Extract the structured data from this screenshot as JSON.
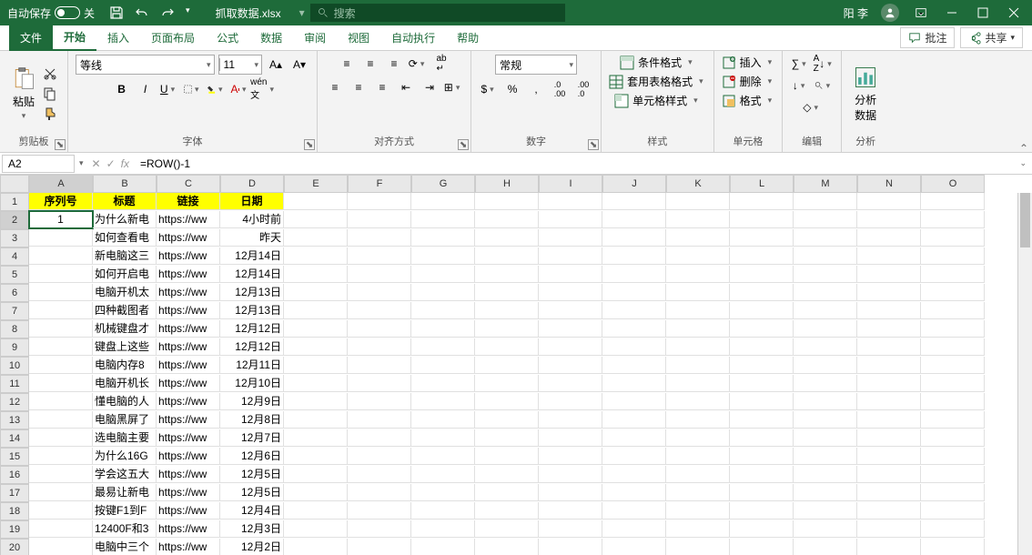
{
  "titlebar": {
    "autosave_label": "自动保存",
    "autosave_off": "关",
    "filename": "抓取数据.xlsx",
    "search_placeholder": "搜索",
    "username": "阳 李"
  },
  "tabs": {
    "file": "文件",
    "home": "开始",
    "insert": "插入",
    "layout": "页面布局",
    "formulas": "公式",
    "data": "数据",
    "review": "审阅",
    "view": "视图",
    "automate": "自动执行",
    "help": "帮助",
    "comments": "批注",
    "share": "共享"
  },
  "ribbon": {
    "clipboard": {
      "label": "剪贴板",
      "paste": "粘贴"
    },
    "font": {
      "label": "字体",
      "name": "等线",
      "size": "11"
    },
    "align": {
      "label": "对齐方式"
    },
    "number": {
      "label": "数字",
      "format": "常规"
    },
    "styles": {
      "label": "样式",
      "cond": "条件格式",
      "table": "套用表格格式",
      "cell": "单元格样式"
    },
    "cells": {
      "label": "单元格",
      "insert": "插入",
      "delete": "删除",
      "format": "格式"
    },
    "editing": {
      "label": "编辑"
    },
    "analysis": {
      "label": "分析",
      "btn": "分析\n数据"
    }
  },
  "formulabar": {
    "namebox": "A2",
    "formula": "=ROW()-1"
  },
  "columns": [
    "A",
    "B",
    "C",
    "D",
    "E",
    "F",
    "G",
    "H",
    "I",
    "J",
    "K",
    "L",
    "M",
    "N",
    "O"
  ],
  "headers": {
    "a": "序列号",
    "b": "标题",
    "c": "链接",
    "d": "日期"
  },
  "rows": [
    {
      "n": 1,
      "a": "1",
      "b": "为什么新电",
      "c": "https://ww",
      "d": "4小时前"
    },
    {
      "n": 2,
      "a": "",
      "b": "如何查看电",
      "c": "https://ww",
      "d": "昨天"
    },
    {
      "n": 3,
      "a": "",
      "b": "新电脑这三",
      "c": "https://ww",
      "d": "12月14日"
    },
    {
      "n": 4,
      "a": "",
      "b": "如何开启电",
      "c": "https://ww",
      "d": "12月14日"
    },
    {
      "n": 5,
      "a": "",
      "b": "电脑开机太",
      "c": "https://ww",
      "d": "12月13日"
    },
    {
      "n": 6,
      "a": "",
      "b": "四种截图者",
      "c": "https://ww",
      "d": "12月13日"
    },
    {
      "n": 7,
      "a": "",
      "b": "机械键盘才",
      "c": "https://ww",
      "d": "12月12日"
    },
    {
      "n": 8,
      "a": "",
      "b": "键盘上这些",
      "c": "https://ww",
      "d": "12月12日"
    },
    {
      "n": 9,
      "a": "",
      "b": "电脑内存8",
      "c": "https://ww",
      "d": "12月11日"
    },
    {
      "n": 10,
      "a": "",
      "b": "电脑开机长",
      "c": "https://ww",
      "d": "12月10日"
    },
    {
      "n": 11,
      "a": "",
      "b": "懂电脑的人",
      "c": "https://ww",
      "d": "12月9日"
    },
    {
      "n": 12,
      "a": "",
      "b": "电脑黑屏了",
      "c": "https://ww",
      "d": "12月8日"
    },
    {
      "n": 13,
      "a": "",
      "b": "选电脑主要",
      "c": "https://ww",
      "d": "12月7日"
    },
    {
      "n": 14,
      "a": "",
      "b": "为什么16G",
      "c": "https://ww",
      "d": "12月6日"
    },
    {
      "n": 15,
      "a": "",
      "b": "学会这五大",
      "c": "https://ww",
      "d": "12月5日"
    },
    {
      "n": 16,
      "a": "",
      "b": "最易让新电",
      "c": "https://ww",
      "d": "12月5日"
    },
    {
      "n": 17,
      "a": "",
      "b": "按键F1到F",
      "c": "https://ww",
      "d": "12月4日"
    },
    {
      "n": 18,
      "a": "",
      "b": "12400F和3",
      "c": "https://ww",
      "d": "12月3日"
    },
    {
      "n": 19,
      "a": "",
      "b": "电脑中三个",
      "c": "https://ww",
      "d": "12月2日"
    }
  ]
}
